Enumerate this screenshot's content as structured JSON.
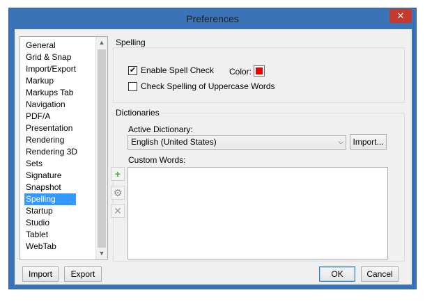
{
  "window": {
    "title": "Preferences",
    "close_glyph": "✕"
  },
  "nav": {
    "items": [
      {
        "label": "General"
      },
      {
        "label": "Grid & Snap"
      },
      {
        "label": "Import/Export"
      },
      {
        "label": "Markup"
      },
      {
        "label": "Markups Tab"
      },
      {
        "label": "Navigation"
      },
      {
        "label": "PDF/A"
      },
      {
        "label": "Presentation"
      },
      {
        "label": "Rendering"
      },
      {
        "label": "Rendering 3D"
      },
      {
        "label": "Sets"
      },
      {
        "label": "Signature"
      },
      {
        "label": "Snapshot"
      },
      {
        "label": "Spelling"
      },
      {
        "label": "Startup"
      },
      {
        "label": "Studio"
      },
      {
        "label": "Tablet"
      },
      {
        "label": "WebTab"
      }
    ],
    "selected_label": "Spelling"
  },
  "spelling": {
    "group_title": "Spelling",
    "enable_label": "Enable Spell Check",
    "enable_checked": true,
    "color_label": "Color:",
    "color_value": "#ee0000",
    "uppercase_label": "Check Spelling of Uppercase Words",
    "uppercase_checked": false
  },
  "dictionaries": {
    "group_title": "Dictionaries",
    "active_label": "Active Dictionary:",
    "active_value": "English (United States)",
    "import_button": "Import...",
    "custom_label": "Custom Words:",
    "add_glyph": "+",
    "settings_glyph": "⚙",
    "remove_glyph": "✕"
  },
  "buttons": {
    "import": "Import",
    "export": "Export",
    "ok": "OK",
    "cancel": "Cancel"
  },
  "colors": {
    "accent": "#3a73b8",
    "selection": "#3399ff",
    "close": "#c7392c"
  }
}
